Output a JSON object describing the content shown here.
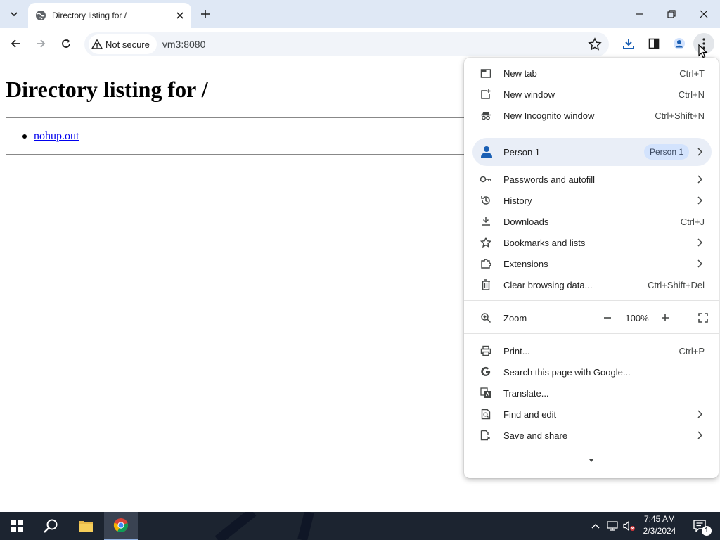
{
  "tabs": [
    {
      "title": "Directory listing for /"
    }
  ],
  "toolbar": {
    "security_label": "Not secure",
    "url": "vm3:8080"
  },
  "page": {
    "heading": "Directory listing for /",
    "files": [
      "nohup.out"
    ]
  },
  "menu": {
    "new_tab": {
      "label": "New tab",
      "shortcut": "Ctrl+T"
    },
    "new_window": {
      "label": "New window",
      "shortcut": "Ctrl+N"
    },
    "new_incognito": {
      "label": "New Incognito window",
      "shortcut": "Ctrl+Shift+N"
    },
    "person": {
      "label": "Person 1",
      "chip": "Person 1"
    },
    "passwords": {
      "label": "Passwords and autofill"
    },
    "history": {
      "label": "History"
    },
    "downloads": {
      "label": "Downloads",
      "shortcut": "Ctrl+J"
    },
    "bookmarks": {
      "label": "Bookmarks and lists"
    },
    "extensions": {
      "label": "Extensions"
    },
    "clear_data": {
      "label": "Clear browsing data...",
      "shortcut": "Ctrl+Shift+Del"
    },
    "zoom": {
      "label": "Zoom",
      "value": "100%"
    },
    "print": {
      "label": "Print...",
      "shortcut": "Ctrl+P"
    },
    "search_google": {
      "label": "Search this page with Google..."
    },
    "translate": {
      "label": "Translate..."
    },
    "find_edit": {
      "label": "Find and edit"
    },
    "save_share": {
      "label": "Save and share"
    }
  },
  "taskbar": {
    "time": "7:45 AM",
    "date": "2/3/2024",
    "notification_count": "1"
  },
  "colors": {
    "tabstrip_bg": "#dfe8f5",
    "omnibox_bg": "#f1f4f9",
    "person_highlight": "#e9eef7",
    "link": "#0000ee",
    "taskbar_bg": "#1c2430"
  }
}
